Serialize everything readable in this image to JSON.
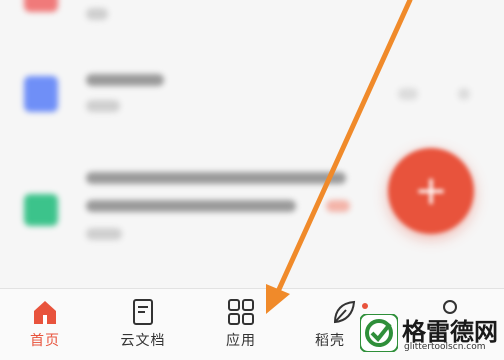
{
  "tabs": [
    {
      "label": "首页",
      "icon": "home-icon",
      "active": true
    },
    {
      "label": "云文档",
      "icon": "document-icon",
      "active": false
    },
    {
      "label": "应用",
      "icon": "apps-grid-icon",
      "active": false
    },
    {
      "label": "稻壳",
      "icon": "leaf-icon",
      "active": false,
      "badge": true
    },
    {
      "label": "",
      "icon": "user-icon",
      "active": false
    }
  ],
  "fab": {
    "icon": "plus-icon"
  },
  "colors": {
    "accent": "#e8533c",
    "arrow": "#f08a2a",
    "doc_blue": "#6f8ff7",
    "doc_green": "#3cc38b"
  },
  "watermark": {
    "name": "格雷德网",
    "url": "glittertoolscn.com"
  }
}
